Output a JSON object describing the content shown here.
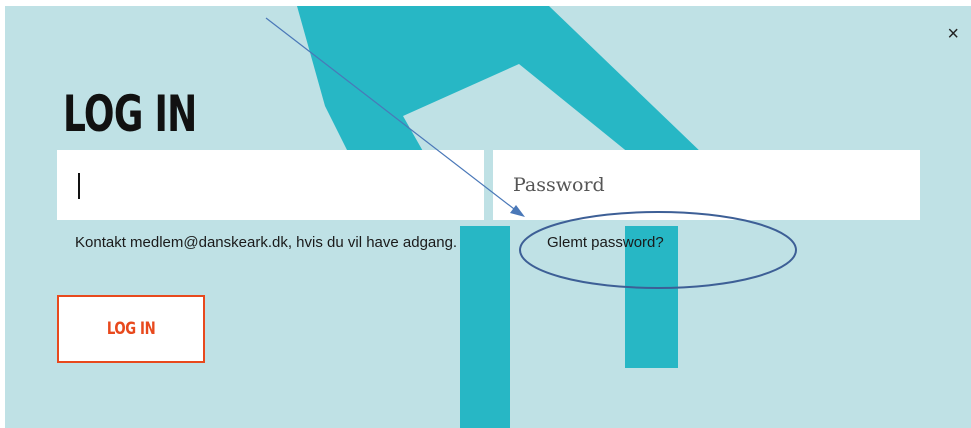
{
  "dialog": {
    "title": "LOG IN",
    "close_label": "×"
  },
  "form": {
    "username": {
      "value": "",
      "placeholder": ""
    },
    "password": {
      "value": "",
      "placeholder": "Password"
    },
    "hint_text": "Kontakt medlem@danskeark.dk, hvis du vil have adgang.",
    "forgot_label": "Glemt password?",
    "submit_label": "LOG IN"
  },
  "colors": {
    "modal_background": "#bfe1e5",
    "logo_teal": "#27b7c5",
    "accent_orange": "#e8491d",
    "annotation_blue": "#4a78b8",
    "annotation_ellipse": "#3d5f96"
  },
  "annotations": {
    "arrow": "arrow pointing to forgot password",
    "ellipse": "circle around forgot password link"
  }
}
